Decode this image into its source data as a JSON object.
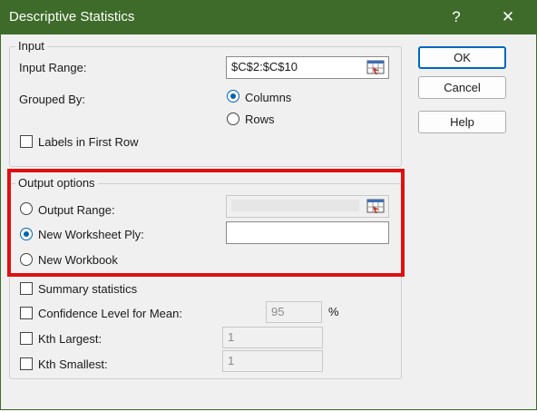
{
  "window": {
    "title": "Descriptive Statistics",
    "help_glyph": "?",
    "close_glyph": "✕"
  },
  "input_group": {
    "legend": "Input",
    "input_range_label": "Input Range:",
    "input_range_value": "$C$2:$C$10",
    "grouped_by_label": "Grouped By:",
    "columns_label": "Columns",
    "rows_label": "Rows",
    "labels_first_row_label": "Labels in First Row",
    "grouped_by_selected": "Columns",
    "labels_first_row_checked": false
  },
  "output_group": {
    "legend": "Output options",
    "output_range_label": "Output Range:",
    "new_worksheet_label": "New Worksheet Ply:",
    "new_workbook_label": "New Workbook",
    "selected": "New Worksheet Ply",
    "output_range_value": "",
    "new_worksheet_value": "",
    "summary_stats_label": "Summary statistics",
    "confidence_label": "Confidence Level for Mean:",
    "confidence_value": "95",
    "percent_sign": "%",
    "kth_largest_label": "Kth Largest:",
    "kth_largest_value": "1",
    "kth_smallest_label": "Kth Smallest:",
    "kth_smallest_value": "1"
  },
  "buttons": {
    "ok": "OK",
    "cancel": "Cancel",
    "help": "Help"
  },
  "highlight_color": "#e01010",
  "accent_color": "#0063b1",
  "titlebar_color": "#3e6b2a"
}
